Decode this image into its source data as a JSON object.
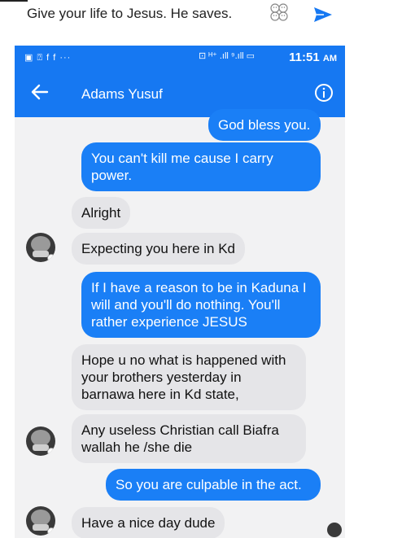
{
  "composer": {
    "draft_text": "Give your life to Jesus. He saves.",
    "emoji_icon": "emoji-sticker-icon",
    "send_icon": "send-arrow-icon",
    "accent": "#1678f2"
  },
  "statusbar": {
    "left_icons": "▣ ⍰ f f ···",
    "right_icons": "⊡ ᴴ⁺ .ıll ⁹.ıll ▭",
    "time": "11:51",
    "ampm": "AM"
  },
  "header": {
    "contact_name": "Adams Yusuf",
    "back_icon": "back-arrow-icon",
    "info_icon": "info-icon",
    "color": "#1678f2"
  },
  "messages": [
    {
      "dir": "out",
      "text": "God bless you."
    },
    {
      "dir": "out",
      "text": "You can't kill me cause I carry power."
    },
    {
      "dir": "in",
      "text": "Alright"
    },
    {
      "dir": "in",
      "text": "Expecting you here in Kd"
    },
    {
      "dir": "out",
      "text": "If I have a reason to be in Kaduna I will and you'll do nothing. You'll rather experience JESUS"
    },
    {
      "dir": "in",
      "text": "Hope u no what is happened with your brothers yesterday in barnawa here in Kd state,"
    },
    {
      "dir": "in",
      "text": "Any useless Christian call Biafra wallah he /she die"
    },
    {
      "dir": "out",
      "text": "So you are culpable in the act."
    },
    {
      "dir": "in",
      "text": "Have a nice day dude"
    }
  ],
  "colors": {
    "outgoing": "#1a7ff6",
    "incoming": "#e5e5e8",
    "background": "#f2f2f3"
  }
}
